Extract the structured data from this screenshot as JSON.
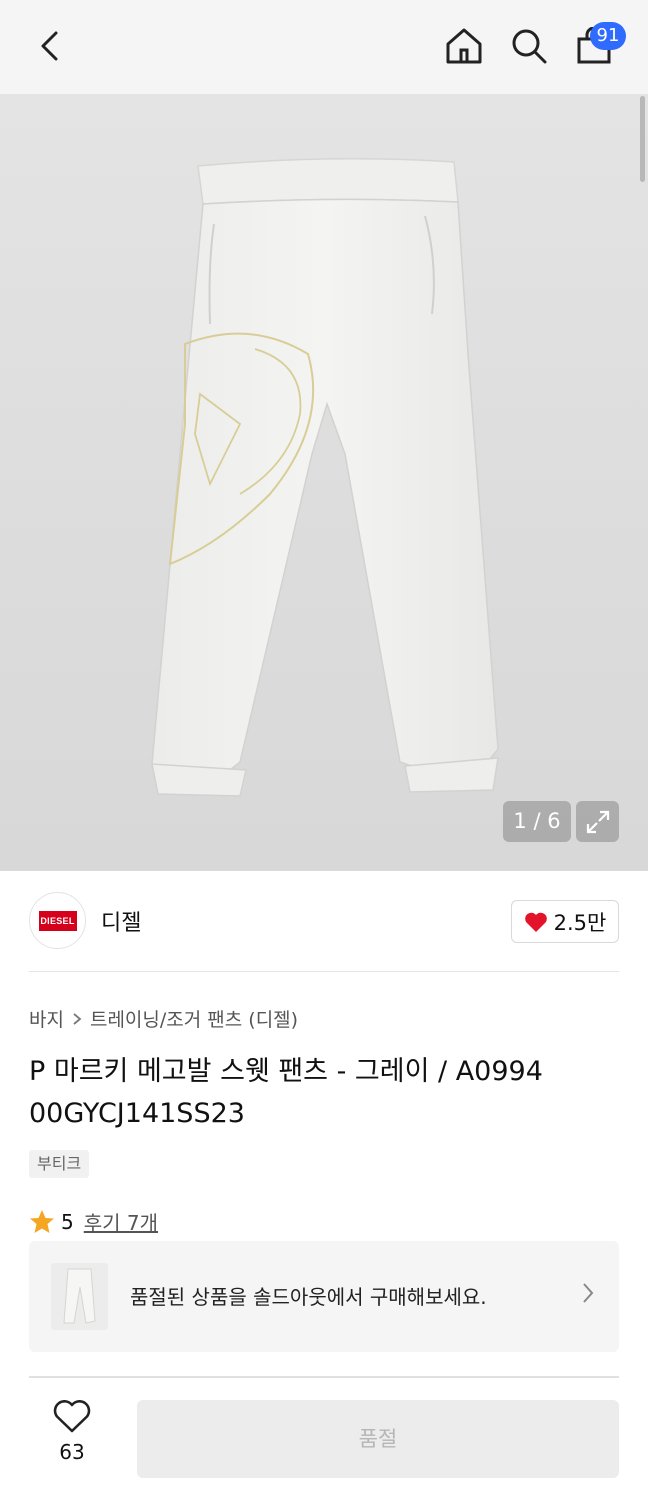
{
  "header": {
    "cart_count": "91",
    "icons": [
      "back-icon",
      "home-icon",
      "search-icon",
      "cart-icon"
    ]
  },
  "gallery": {
    "counter": "1 / 6"
  },
  "brand": {
    "logo_text": "DIESEL",
    "name": "디젤",
    "likes": "2.5만",
    "logo_color": "#d5001c",
    "heart_color": "#e3132b"
  },
  "product": {
    "breadcrumb": [
      "바지",
      "트레이닝/조거 팬츠 (디젤)"
    ],
    "title": "P 마르키 메고발 스웻 팬츠 - 그레이 / A0994 00GYCJ141SS23",
    "tag": "부티크",
    "rating": "5",
    "review_link": "후기 7개",
    "star_color": "#f5a623"
  },
  "soldout_banner": {
    "text": "품절된 상품을 솔드아웃에서 구매해보세요."
  },
  "bottom_bar": {
    "wish_count": "63",
    "action_label": "품절"
  }
}
